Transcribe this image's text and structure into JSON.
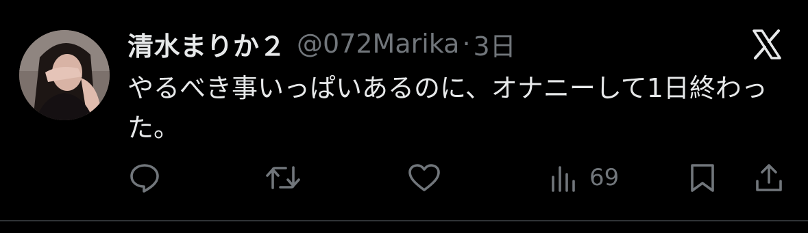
{
  "post": {
    "author": {
      "display_name": "清水まりか２",
      "handle": "@072Marika",
      "avatar": "avatar"
    },
    "separator": "·",
    "timestamp": "3日",
    "text": "やるべき事いっぱいあるのに、オナニーして1日終わった。",
    "platform_icon": "x-logo-icon"
  },
  "actions": {
    "reply_icon": "reply-icon",
    "repost_icon": "repost-icon",
    "like_icon": "like-icon",
    "views_icon": "views-icon",
    "views_count": "69",
    "bookmark_icon": "bookmark-icon",
    "share_icon": "share-icon"
  },
  "colors": {
    "background": "#000000",
    "primary_text": "#e7e9ea",
    "secondary_text": "#71767b",
    "divider": "#2f3336"
  }
}
